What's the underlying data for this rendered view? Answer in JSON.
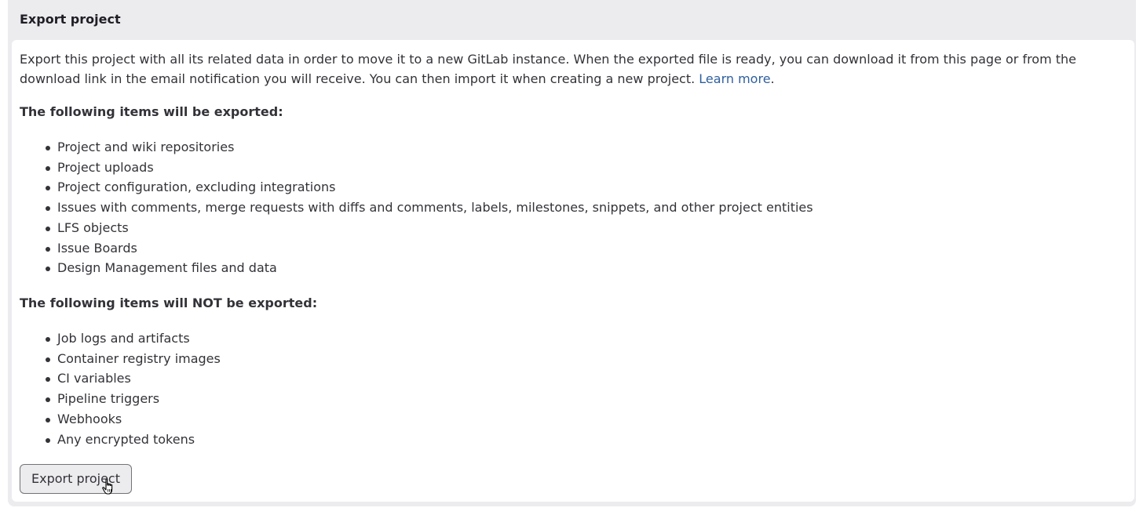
{
  "panel": {
    "title": "Export project"
  },
  "intro": {
    "text": "Export this project with all its related data in order to move it to a new GitLab instance. When the exported file is ready, you can download it from this page or from the download link in the email notification you will receive. You can then import it when creating a new project. ",
    "link_label": "Learn more",
    "trailing": "."
  },
  "exported": {
    "title": "The following items will be exported:",
    "items": [
      "Project and wiki repositories",
      "Project uploads",
      "Project configuration, excluding integrations",
      "Issues with comments, merge requests with diffs and comments, labels, milestones, snippets, and other project entities",
      "LFS objects",
      "Issue Boards",
      "Design Management files and data"
    ]
  },
  "not_exported": {
    "title": "The following items will NOT be exported:",
    "items": [
      "Job logs and artifacts",
      "Container registry images",
      "CI variables",
      "Pipeline triggers",
      "Webhooks",
      "Any encrypted tokens"
    ]
  },
  "actions": {
    "export_label": "Export project"
  },
  "colors": {
    "link": "#2f5f9e",
    "panel_bg": "#ececef",
    "text": "#333238"
  },
  "icons": {
    "cursor": "hand-pointer-icon"
  }
}
